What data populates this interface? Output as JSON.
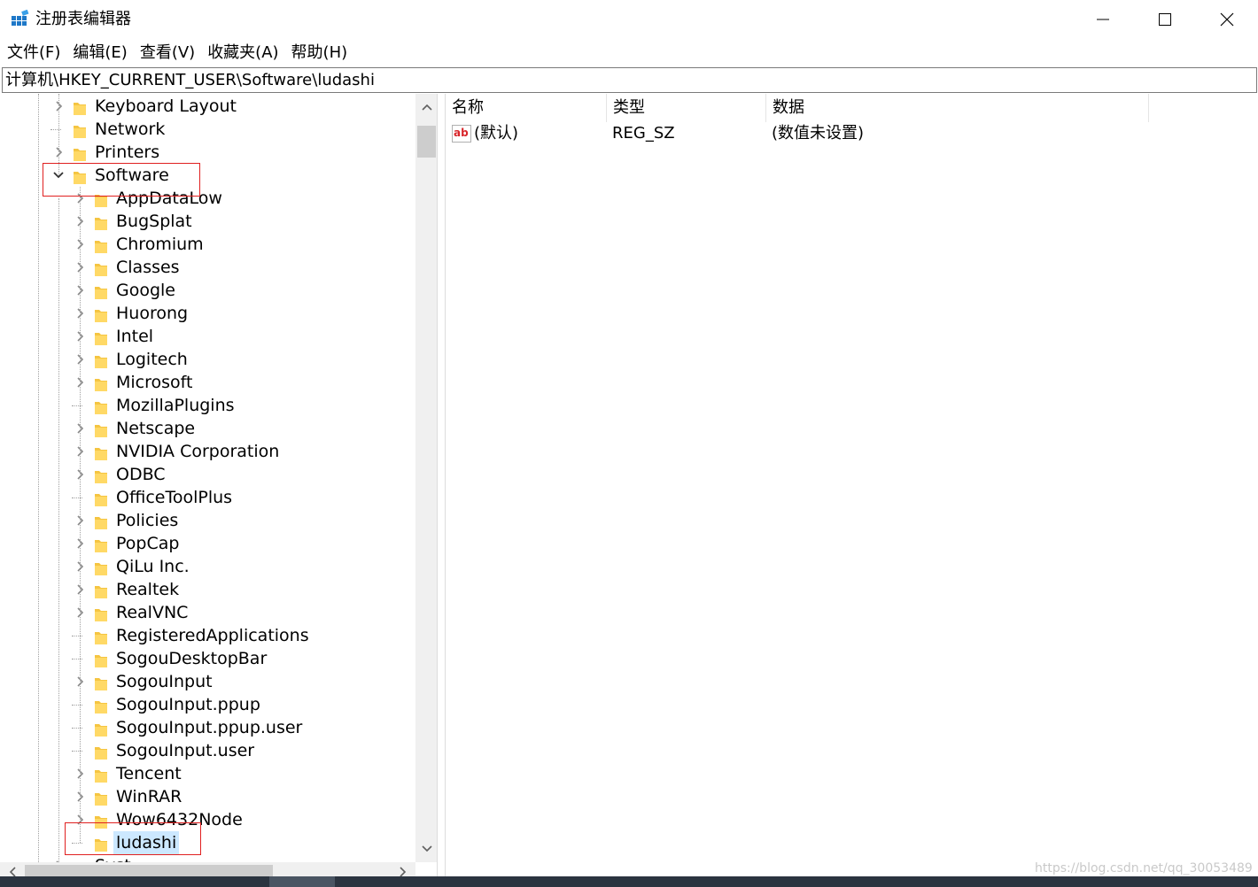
{
  "window": {
    "title": "注册表编辑器",
    "icon": "registry-editor-icon"
  },
  "menu": [
    {
      "label": "文件(F)"
    },
    {
      "label": "编辑(E)"
    },
    {
      "label": "查看(V)"
    },
    {
      "label": "收藏夹(A)"
    },
    {
      "label": "帮助(H)"
    }
  ],
  "address": {
    "path": "计算机\\HKEY_CURRENT_USER\\Software\\ludashi"
  },
  "tree": {
    "top_items": [
      {
        "label": "Keyboard Layout",
        "expander": "collapsed"
      },
      {
        "label": "Network",
        "expander": "none"
      },
      {
        "label": "Printers",
        "expander": "collapsed"
      },
      {
        "label": "Software",
        "expander": "expanded"
      }
    ],
    "software_children": [
      {
        "label": "AppDataLow",
        "expander": "collapsed"
      },
      {
        "label": "BugSplat",
        "expander": "collapsed"
      },
      {
        "label": "Chromium",
        "expander": "collapsed"
      },
      {
        "label": "Classes",
        "expander": "collapsed"
      },
      {
        "label": "Google",
        "expander": "collapsed"
      },
      {
        "label": "Huorong",
        "expander": "collapsed"
      },
      {
        "label": "Intel",
        "expander": "collapsed"
      },
      {
        "label": "Logitech",
        "expander": "collapsed"
      },
      {
        "label": "Microsoft",
        "expander": "collapsed"
      },
      {
        "label": "MozillaPlugins",
        "expander": "none"
      },
      {
        "label": "Netscape",
        "expander": "collapsed"
      },
      {
        "label": "NVIDIA Corporation",
        "expander": "collapsed"
      },
      {
        "label": "ODBC",
        "expander": "collapsed"
      },
      {
        "label": "OfficeToolPlus",
        "expander": "none"
      },
      {
        "label": "Policies",
        "expander": "collapsed"
      },
      {
        "label": "PopCap",
        "expander": "collapsed"
      },
      {
        "label": "QiLu Inc.",
        "expander": "collapsed"
      },
      {
        "label": "Realtek",
        "expander": "collapsed"
      },
      {
        "label": "RealVNC",
        "expander": "collapsed"
      },
      {
        "label": "RegisteredApplications",
        "expander": "none"
      },
      {
        "label": "SogouDesktopBar",
        "expander": "none"
      },
      {
        "label": "SogouInput",
        "expander": "collapsed"
      },
      {
        "label": "SogouInput.ppup",
        "expander": "none"
      },
      {
        "label": "SogouInput.ppup.user",
        "expander": "none"
      },
      {
        "label": "SogouInput.user",
        "expander": "none"
      },
      {
        "label": "Tencent",
        "expander": "collapsed"
      },
      {
        "label": "WinRAR",
        "expander": "collapsed"
      },
      {
        "label": "Wow6432Node",
        "expander": "collapsed"
      },
      {
        "label": "ludashi",
        "expander": "none",
        "selected": true
      }
    ],
    "partial_next_item": "Syst"
  },
  "values": {
    "columns": {
      "name": "名称",
      "type": "类型",
      "data": "数据"
    },
    "rows": [
      {
        "name": "(默认)",
        "type": "REG_SZ",
        "data": "(数值未设置)",
        "icon": "reg-string-icon"
      }
    ]
  },
  "watermark": "https://blog.csdn.net/qq_30053489",
  "colors": {
    "selection": "#cce8ff",
    "highlight_box": "#e02020",
    "folder": "#f5c542"
  }
}
